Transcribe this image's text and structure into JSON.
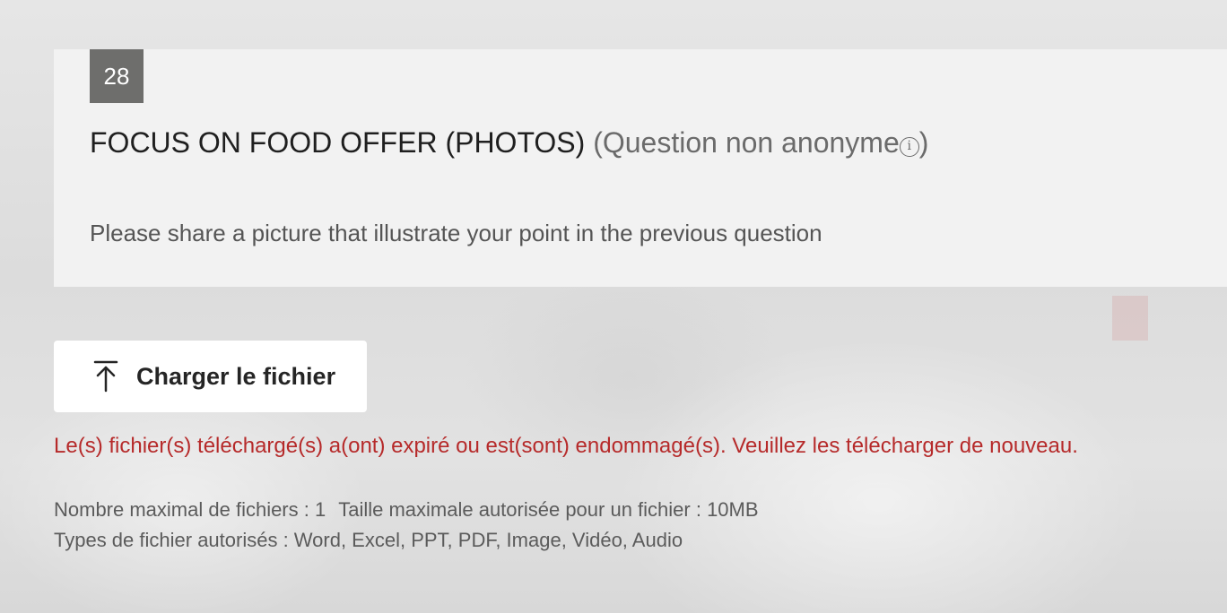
{
  "question": {
    "number": "28",
    "title": "FOCUS ON FOOD OFFER (PHOTOS)",
    "title_suffix_open": "(Question non anonyme",
    "title_suffix_close": ")",
    "info_icon_glyph": "i",
    "subtitle": "Please share a picture that illustrate your point in the previous question"
  },
  "upload": {
    "label": "Charger le fichier",
    "icon": "upload-arrow-icon"
  },
  "error": {
    "message": "Le(s) fichier(s) téléchargé(s) a(ont) expiré ou est(sont) endommagé(s). Veuillez les télécharger de nouveau.",
    "color": "#b62a2a"
  },
  "limits": {
    "max_files": "Nombre maximal de fichiers : 1",
    "max_size": "Taille maximale autorisée pour un fichier : 10MB",
    "allowed_types": "Types de fichier autorisés : Word, Excel, PPT, PDF, Image, Vidéo, Audio"
  },
  "colors": {
    "number_badge": "#6e6e6c",
    "card_background": "#f2f2f2"
  }
}
